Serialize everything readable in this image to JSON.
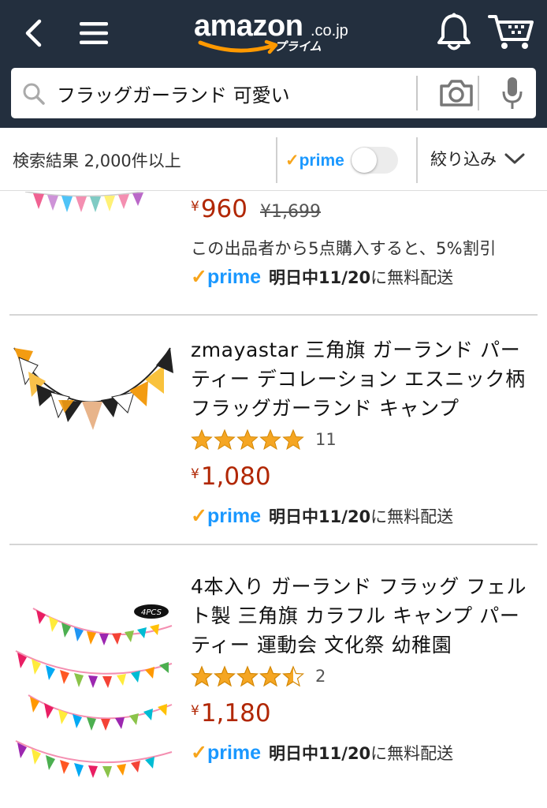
{
  "header": {
    "logo_word": "amazon",
    "logo_suffix": ".co.jp",
    "logo_prime": "プライム",
    "search_value": "フラッグガーランド 可愛い"
  },
  "filter": {
    "result_count": "検索結果 2,000件以上",
    "prime_check": "✓",
    "prime_label": "prime",
    "refine_label": "絞り込み"
  },
  "products": [
    {
      "yen": "¥",
      "price": "960",
      "list_price": "¥1,699",
      "deal_note": "この出品者から5点購入すると、5%割引",
      "prime_check": "✓",
      "prime_label": "prime",
      "delivery_date": "明日中11/20",
      "delivery_suffix": "に無料配送"
    },
    {
      "title": "zmayastar 三角旗 ガーランド パーティー デコレーション エスニック柄 フラッグガーランド キャンプ",
      "rating": 5,
      "review_count": "11",
      "yen": "¥",
      "price": "1,080",
      "prime_check": "✓",
      "prime_label": "prime",
      "delivery_date": "明日中11/20",
      "delivery_suffix": "に無料配送"
    },
    {
      "title": "4本入り ガーランド フラッグ フェルト製 三角旗 カラフル キャンプ パーティー 運動会 文化祭 幼稚園",
      "rating": 4.5,
      "review_count": "2",
      "yen": "¥",
      "price": "1,180",
      "image_badge": "4PCS",
      "prime_check": "✓",
      "prime_label": "prime",
      "delivery_date": "明日中11/20",
      "delivery_suffix": "に無料配送"
    }
  ],
  "colors": {
    "header_bg": "#232f3e",
    "price": "#b12704",
    "prime_blue": "#1a98ff",
    "prime_check": "#f7a51c",
    "star": "#f5a623"
  }
}
